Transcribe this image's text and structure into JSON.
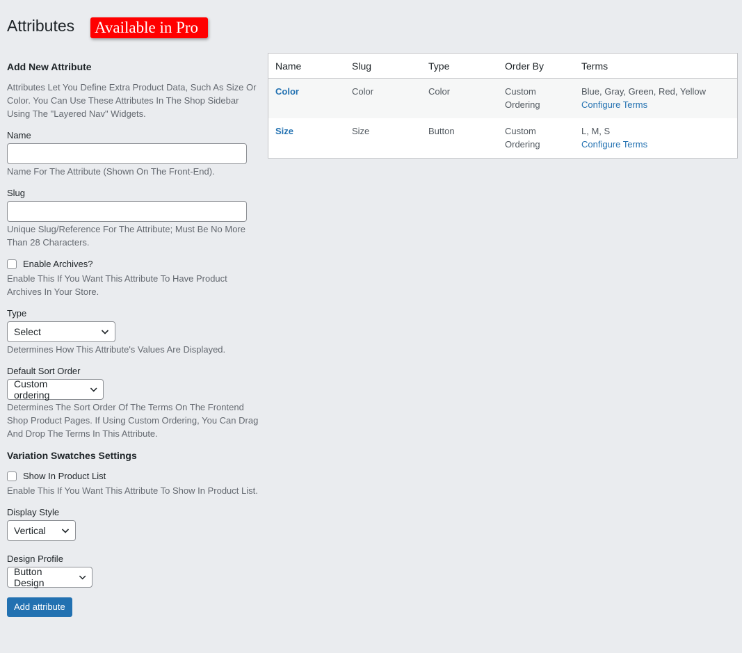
{
  "header": {
    "title": "Attributes",
    "pro_badge": "Available in Pro"
  },
  "form": {
    "heading": "Add New Attribute",
    "intro": "Attributes Let You Define Extra Product Data, Such As Size Or Color. You Can Use These Attributes In The Shop Sidebar Using The \"Layered Nav\" Widgets.",
    "name_label": "Name",
    "name_value": "",
    "name_desc": "Name For The Attribute (Shown On The Front-End).",
    "slug_label": "Slug",
    "slug_value": "",
    "slug_desc": "Unique Slug/Reference For The Attribute; Must Be No More Than 28 Characters.",
    "archives_label": "Enable Archives?",
    "archives_checked": false,
    "archives_desc": "Enable This If You Want This Attribute To Have Product Archives In Your Store.",
    "type_label": "Type",
    "type_value": "Select",
    "type_desc": "Determines How This Attribute's Values Are Displayed.",
    "sort_label": "Default Sort Order",
    "sort_value": "Custom ordering",
    "sort_desc": "Determines The Sort Order Of The Terms On The Frontend Shop Product Pages. If Using Custom Ordering, You Can Drag And Drop The Terms In This Attribute.",
    "swatches_heading": "Variation Swatches Settings",
    "show_list_label": "Show In Product List",
    "show_list_checked": false,
    "show_list_desc": "Enable This If You Want This Attribute To Show In Product List.",
    "display_label": "Display Style",
    "display_value": "Vertical",
    "profile_label": "Design Profile",
    "profile_value": "Button Design",
    "submit_label": "Add attribute"
  },
  "table": {
    "headers": {
      "name": "Name",
      "slug": "Slug",
      "type": "Type",
      "order_by": "Order By",
      "terms": "Terms"
    },
    "rows": [
      {
        "name": "Color",
        "slug": "Color",
        "type": "Color",
        "order_by": "Custom Ordering",
        "terms": "Blue, Gray, Green, Red, Yellow",
        "configure": "Configure Terms"
      },
      {
        "name": "Size",
        "slug": "Size",
        "type": "Button",
        "order_by": "Custom Ordering",
        "terms": "L, M, S",
        "configure": "Configure Terms"
      }
    ]
  },
  "colors": {
    "background": "#eaecef",
    "accent": "#2271b1",
    "pro_badge": "#ff0000"
  },
  "icons": {
    "select_arrow": "chevron-down-icon"
  }
}
